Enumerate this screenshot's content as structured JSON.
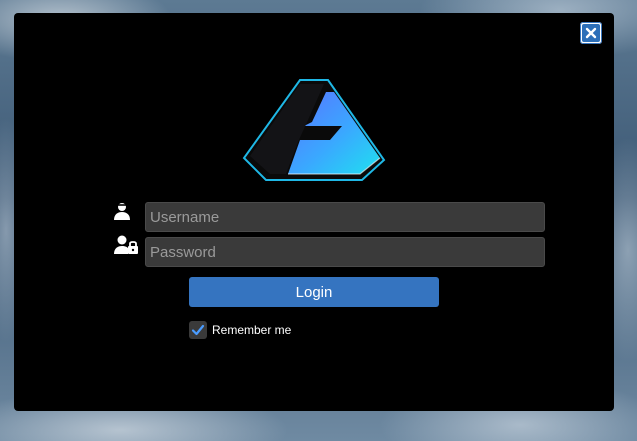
{
  "dialog": {
    "close_icon": "close-icon",
    "logo_icon": "app-logo"
  },
  "form": {
    "username": {
      "icon": "user-icon",
      "placeholder": "Username",
      "value": ""
    },
    "password": {
      "icon": "user-lock-icon",
      "placeholder": "Password",
      "value": ""
    },
    "login_label": "Login",
    "remember": {
      "label": "Remember me",
      "checked": true,
      "icon": "checkmark-icon"
    }
  },
  "colors": {
    "accent": "#3574c0",
    "dialog_bg": "#000000",
    "field_bg": "#3a3a3a",
    "logo_cyan": "#22d3f0",
    "logo_blue": "#4a8cff"
  }
}
